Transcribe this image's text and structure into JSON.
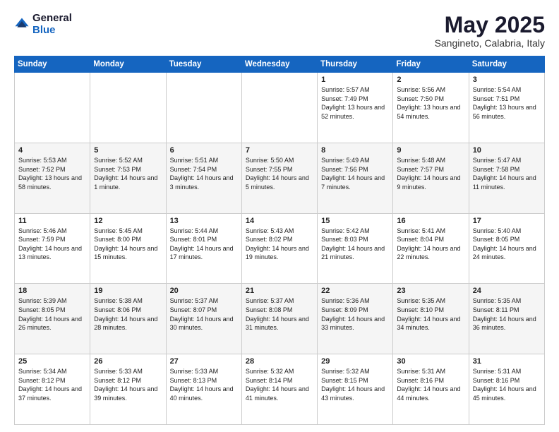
{
  "logo": {
    "general": "General",
    "blue": "Blue"
  },
  "header": {
    "month": "May 2025",
    "location": "Sangineto, Calabria, Italy"
  },
  "weekdays": [
    "Sunday",
    "Monday",
    "Tuesday",
    "Wednesday",
    "Thursday",
    "Friday",
    "Saturday"
  ],
  "weeks": [
    [
      {
        "day": "",
        "sunrise": "",
        "sunset": "",
        "daylight": ""
      },
      {
        "day": "",
        "sunrise": "",
        "sunset": "",
        "daylight": ""
      },
      {
        "day": "",
        "sunrise": "",
        "sunset": "",
        "daylight": ""
      },
      {
        "day": "",
        "sunrise": "",
        "sunset": "",
        "daylight": ""
      },
      {
        "day": "1",
        "sunrise": "5:57 AM",
        "sunset": "7:49 PM",
        "daylight": "13 hours and 52 minutes."
      },
      {
        "day": "2",
        "sunrise": "5:56 AM",
        "sunset": "7:50 PM",
        "daylight": "13 hours and 54 minutes."
      },
      {
        "day": "3",
        "sunrise": "5:54 AM",
        "sunset": "7:51 PM",
        "daylight": "13 hours and 56 minutes."
      }
    ],
    [
      {
        "day": "4",
        "sunrise": "5:53 AM",
        "sunset": "7:52 PM",
        "daylight": "13 hours and 58 minutes."
      },
      {
        "day": "5",
        "sunrise": "5:52 AM",
        "sunset": "7:53 PM",
        "daylight": "14 hours and 1 minute."
      },
      {
        "day": "6",
        "sunrise": "5:51 AM",
        "sunset": "7:54 PM",
        "daylight": "14 hours and 3 minutes."
      },
      {
        "day": "7",
        "sunrise": "5:50 AM",
        "sunset": "7:55 PM",
        "daylight": "14 hours and 5 minutes."
      },
      {
        "day": "8",
        "sunrise": "5:49 AM",
        "sunset": "7:56 PM",
        "daylight": "14 hours and 7 minutes."
      },
      {
        "day": "9",
        "sunrise": "5:48 AM",
        "sunset": "7:57 PM",
        "daylight": "14 hours and 9 minutes."
      },
      {
        "day": "10",
        "sunrise": "5:47 AM",
        "sunset": "7:58 PM",
        "daylight": "14 hours and 11 minutes."
      }
    ],
    [
      {
        "day": "11",
        "sunrise": "5:46 AM",
        "sunset": "7:59 PM",
        "daylight": "14 hours and 13 minutes."
      },
      {
        "day": "12",
        "sunrise": "5:45 AM",
        "sunset": "8:00 PM",
        "daylight": "14 hours and 15 minutes."
      },
      {
        "day": "13",
        "sunrise": "5:44 AM",
        "sunset": "8:01 PM",
        "daylight": "14 hours and 17 minutes."
      },
      {
        "day": "14",
        "sunrise": "5:43 AM",
        "sunset": "8:02 PM",
        "daylight": "14 hours and 19 minutes."
      },
      {
        "day": "15",
        "sunrise": "5:42 AM",
        "sunset": "8:03 PM",
        "daylight": "14 hours and 21 minutes."
      },
      {
        "day": "16",
        "sunrise": "5:41 AM",
        "sunset": "8:04 PM",
        "daylight": "14 hours and 22 minutes."
      },
      {
        "day": "17",
        "sunrise": "5:40 AM",
        "sunset": "8:05 PM",
        "daylight": "14 hours and 24 minutes."
      }
    ],
    [
      {
        "day": "18",
        "sunrise": "5:39 AM",
        "sunset": "8:05 PM",
        "daylight": "14 hours and 26 minutes."
      },
      {
        "day": "19",
        "sunrise": "5:38 AM",
        "sunset": "8:06 PM",
        "daylight": "14 hours and 28 minutes."
      },
      {
        "day": "20",
        "sunrise": "5:37 AM",
        "sunset": "8:07 PM",
        "daylight": "14 hours and 30 minutes."
      },
      {
        "day": "21",
        "sunrise": "5:37 AM",
        "sunset": "8:08 PM",
        "daylight": "14 hours and 31 minutes."
      },
      {
        "day": "22",
        "sunrise": "5:36 AM",
        "sunset": "8:09 PM",
        "daylight": "14 hours and 33 minutes."
      },
      {
        "day": "23",
        "sunrise": "5:35 AM",
        "sunset": "8:10 PM",
        "daylight": "14 hours and 34 minutes."
      },
      {
        "day": "24",
        "sunrise": "5:35 AM",
        "sunset": "8:11 PM",
        "daylight": "14 hours and 36 minutes."
      }
    ],
    [
      {
        "day": "25",
        "sunrise": "5:34 AM",
        "sunset": "8:12 PM",
        "daylight": "14 hours and 37 minutes."
      },
      {
        "day": "26",
        "sunrise": "5:33 AM",
        "sunset": "8:12 PM",
        "daylight": "14 hours and 39 minutes."
      },
      {
        "day": "27",
        "sunrise": "5:33 AM",
        "sunset": "8:13 PM",
        "daylight": "14 hours and 40 minutes."
      },
      {
        "day": "28",
        "sunrise": "5:32 AM",
        "sunset": "8:14 PM",
        "daylight": "14 hours and 41 minutes."
      },
      {
        "day": "29",
        "sunrise": "5:32 AM",
        "sunset": "8:15 PM",
        "daylight": "14 hours and 43 minutes."
      },
      {
        "day": "30",
        "sunrise": "5:31 AM",
        "sunset": "8:16 PM",
        "daylight": "14 hours and 44 minutes."
      },
      {
        "day": "31",
        "sunrise": "5:31 AM",
        "sunset": "8:16 PM",
        "daylight": "14 hours and 45 minutes."
      }
    ]
  ]
}
